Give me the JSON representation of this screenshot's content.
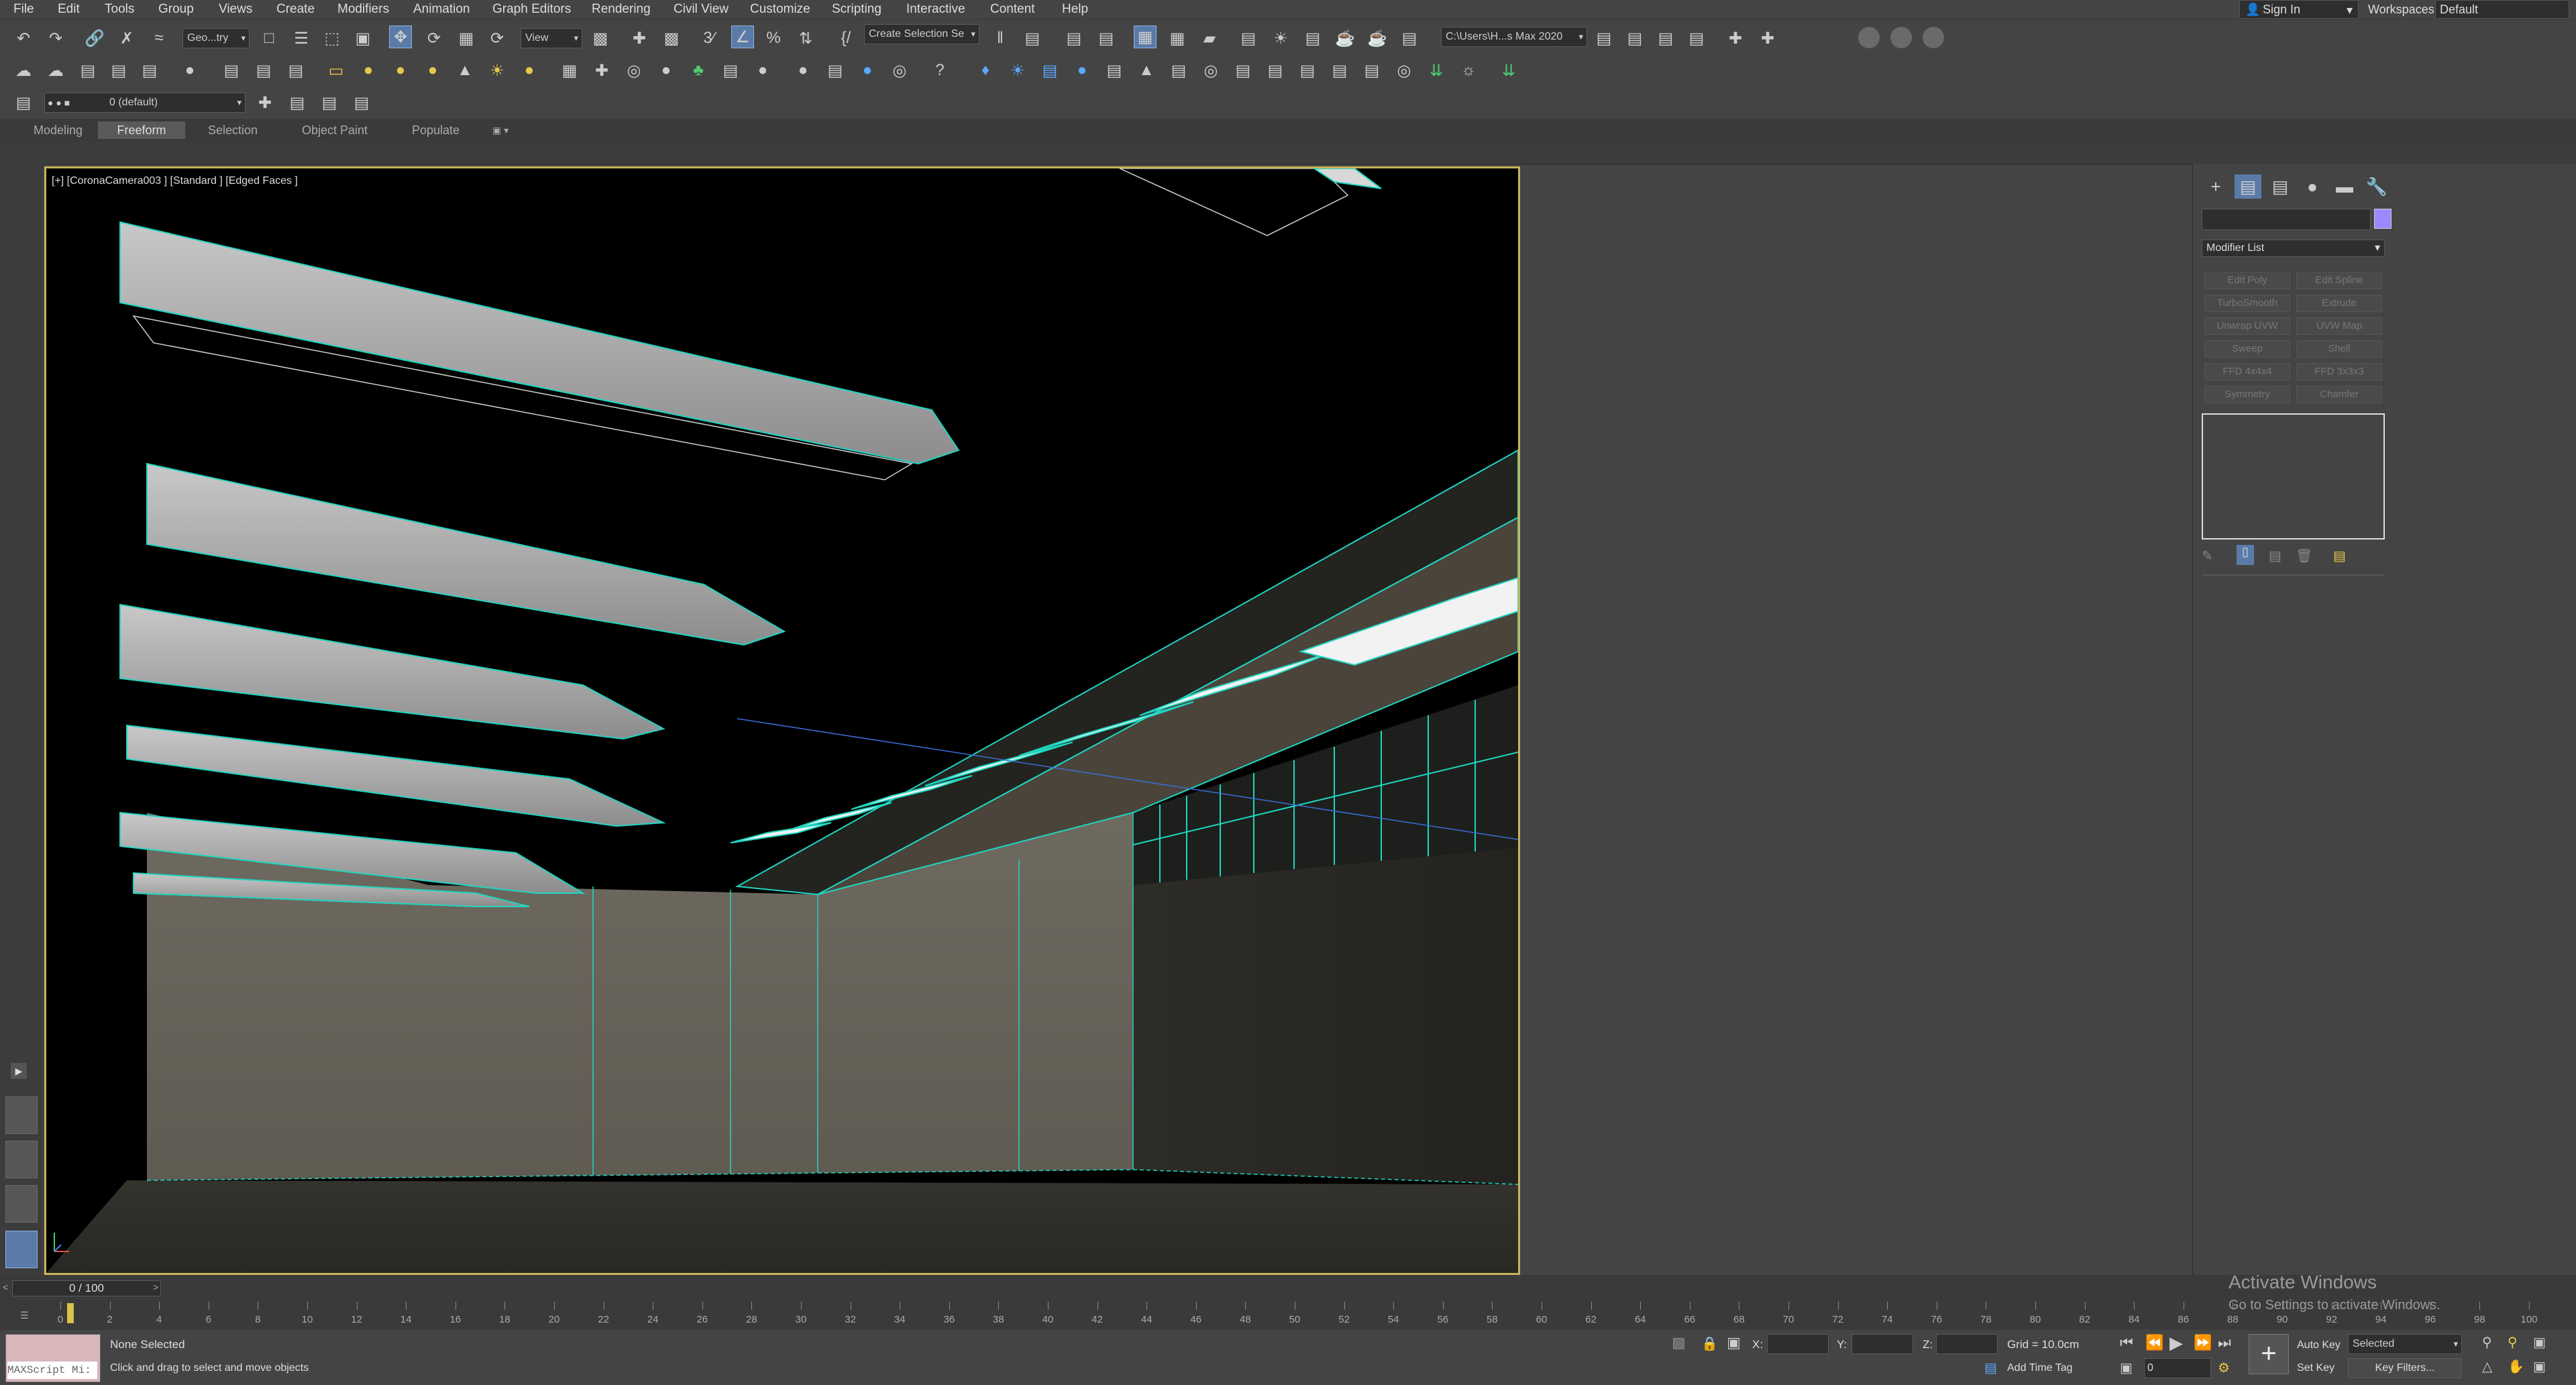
{
  "menu": [
    "File",
    "Edit",
    "Tools",
    "Group",
    "Views",
    "Create",
    "Modifiers",
    "Animation",
    "Graph Editors",
    "Rendering",
    "Civil View",
    "Customize",
    "Scripting",
    "Interactive",
    "Content",
    "Help"
  ],
  "account": {
    "sign_in": "Sign In",
    "workspaces_label": "Workspaces:",
    "workspace": "Default"
  },
  "toolbar": {
    "selection_filter": "Geo...try",
    "ref_coord": "View",
    "named_selection": "Create Selection Se",
    "project_path": "C:\\Users\\H...s Max 2020",
    "layer": "0 (default)"
  },
  "ribbon_tabs": [
    "Modeling",
    "Freeform",
    "Selection",
    "Object Paint",
    "Populate"
  ],
  "ribbon_active": "Freeform",
  "viewport": {
    "label": "[+] [CoronaCamera003 ] [Standard ] [Edged Faces ]"
  },
  "command_panel": {
    "modifier_list": "Modifier List",
    "modifier_buttons": [
      "Edit Poly",
      "Edit Spline",
      "TurboSmooth",
      "Extrude",
      "Unwrap UVW",
      "UVW Map",
      "Sweep",
      "Shell",
      "FFD 4x4x4",
      "FFD 3x3x3",
      "Symmetry",
      "Chamfer"
    ]
  },
  "timeline": {
    "frame": "0 / 100",
    "ticks": [
      "0",
      "2",
      "4",
      "6",
      "8",
      "10",
      "12",
      "14",
      "16",
      "18",
      "20",
      "22",
      "24",
      "26",
      "28",
      "30",
      "32",
      "34",
      "36",
      "38",
      "40",
      "42",
      "44",
      "46",
      "48",
      "50",
      "52",
      "54",
      "56",
      "58",
      "60",
      "62",
      "64",
      "66",
      "68",
      "70",
      "72",
      "74",
      "76",
      "78",
      "80",
      "82",
      "84",
      "86",
      "88",
      "90",
      "92",
      "94",
      "96",
      "98",
      "100"
    ]
  },
  "status": {
    "maxscript": "MAXScript Mi:",
    "selection": "None Selected",
    "prompt": "Click and drag to select and move objects",
    "x_label": "X:",
    "y_label": "Y:",
    "z_label": "Z:",
    "grid": "Grid = 10.0cm",
    "add_time_tag": "Add Time Tag",
    "auto_key": "Auto Key",
    "set_key": "Set Key",
    "key_mode": "Selected",
    "key_filters": "Key Filters...",
    "frame_field": "0"
  },
  "watermark": {
    "title": "Activate Windows",
    "subtitle": "Go to Settings to activate Windows."
  },
  "colors": {
    "viewport_border": "#c9b35a",
    "selection_active": "#5a7ba8",
    "wireframe_cyan": "#1fd6c0"
  }
}
